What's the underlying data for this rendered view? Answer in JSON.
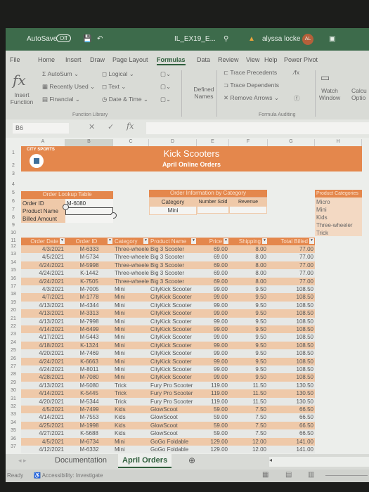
{
  "titlebar": {
    "autosave": "AutoSave",
    "autosave_state": "Off",
    "filename": "IL_EX19_E...",
    "user": "alyssa locke",
    "initials": "AL"
  },
  "ribbon": {
    "tabs": [
      "File",
      "Home",
      "Insert",
      "Draw",
      "Page Layout",
      "Formulas",
      "Data",
      "Review",
      "View",
      "Help",
      "Power Pivot"
    ],
    "active_tab": "Formulas",
    "insert_function": "Insert Function",
    "autosum": "AutoSum",
    "recently_used": "Recently Used",
    "financial": "Financial",
    "logical": "Logical",
    "text": "Text",
    "date_time": "Date & Time",
    "function_library": "Function Library",
    "defined_names": "Defined Names",
    "trace_precedents": "Trace Precedents",
    "trace_dependents": "Trace Dependents",
    "remove_arrows": "Remove Arrows",
    "formula_auditing": "Formula Auditing",
    "watch_window": "Watch Window",
    "calc_options": "Calcu Optio"
  },
  "formula_bar": {
    "name_box": "B6",
    "value": ""
  },
  "columns": [
    "A",
    "B",
    "C",
    "D",
    "E",
    "F",
    "G",
    "H"
  ],
  "sheet": {
    "logo_text": "CITY SPORTS",
    "title": "Kick Scooters",
    "subtitle": "April Online Orders",
    "lookup": {
      "header": "Order Lookup Table",
      "labels": [
        "Order ID",
        "Product Name",
        "Billed Amount"
      ],
      "order_id": "M-6080"
    },
    "category_info": {
      "header": "Order Information by Category",
      "columns": [
        "Category",
        "Number Sold",
        "Revenue"
      ],
      "category": "Mini"
    },
    "product_categories": {
      "header": "Product Categories",
      "items": [
        "Micro",
        "Mini",
        "Kids",
        "Three-wheeler",
        "Trick"
      ]
    },
    "table_headers": [
      "Order Date",
      "Order ID",
      "Category",
      "Product Name",
      "Price",
      "Shipping",
      "Total Billed"
    ],
    "rows": [
      [
        "4/3/2021",
        "M-6333",
        "Three-wheeler",
        "Big 3 Scooter",
        "69.00",
        "8.00",
        "77.00"
      ],
      [
        "4/5/2021",
        "M-5734",
        "Three-wheeler",
        "Big 3 Scooter",
        "69.00",
        "8.00",
        "77.00"
      ],
      [
        "4/24/2021",
        "M-5998",
        "Three-wheeler",
        "Big 3 Scooter",
        "69.00",
        "8.00",
        "77.00"
      ],
      [
        "4/24/2021",
        "K-1442",
        "Three-wheeler",
        "Big 3 Scooter",
        "69.00",
        "8.00",
        "77.00"
      ],
      [
        "4/24/2021",
        "K-7505",
        "Three-wheeler",
        "Big 3 Scooter",
        "69.00",
        "8.00",
        "77.00"
      ],
      [
        "4/3/2021",
        "M-7005",
        "Mini",
        "CityKick Scooter",
        "99.00",
        "9.50",
        "108.50"
      ],
      [
        "4/7/2021",
        "M-1778",
        "Mini",
        "CityKick Scooter",
        "99.00",
        "9.50",
        "108.50"
      ],
      [
        "4/13/2021",
        "M-4344",
        "Mini",
        "CityKick Scooter",
        "99.00",
        "9.50",
        "108.50"
      ],
      [
        "4/13/2021",
        "M-3313",
        "Mini",
        "CityKick Scooter",
        "99.00",
        "9.50",
        "108.50"
      ],
      [
        "4/13/2021",
        "M-7998",
        "Mini",
        "CityKick Scooter",
        "99.00",
        "9.50",
        "108.50"
      ],
      [
        "4/14/2021",
        "M-6499",
        "Mini",
        "CityKick Scooter",
        "99.00",
        "9.50",
        "108.50"
      ],
      [
        "4/17/2021",
        "M-5443",
        "Mini",
        "CityKick Scooter",
        "99.00",
        "9.50",
        "108.50"
      ],
      [
        "4/18/2021",
        "K-1324",
        "Mini",
        "CityKick Scooter",
        "99.00",
        "9.50",
        "108.50"
      ],
      [
        "4/20/2021",
        "M-7469",
        "Mini",
        "CityKick Scooter",
        "99.00",
        "9.50",
        "108.50"
      ],
      [
        "4/24/2021",
        "K-6663",
        "Mini",
        "CityKick Scooter",
        "99.00",
        "9.50",
        "108.50"
      ],
      [
        "4/24/2021",
        "M-8011",
        "Mini",
        "CityKick Scooter",
        "99.00",
        "9.50",
        "108.50"
      ],
      [
        "4/28/2021",
        "M-7080",
        "Mini",
        "CityKick Scooter",
        "99.00",
        "9.50",
        "108.50"
      ],
      [
        "4/13/2021",
        "M-5080",
        "Trick",
        "Fury Pro Scooter",
        "119.00",
        "11.50",
        "130.50"
      ],
      [
        "4/14/2021",
        "K-5445",
        "Trick",
        "Fury Pro Scooter",
        "119.00",
        "11.50",
        "130.50"
      ],
      [
        "4/20/2021",
        "M-5344",
        "Trick",
        "Fury Pro Scooter",
        "119.00",
        "11.50",
        "130.50"
      ],
      [
        "4/5/2021",
        "M-7499",
        "Kids",
        "GlowScoot",
        "59.00",
        "7.50",
        "66.50"
      ],
      [
        "4/14/2021",
        "M-7553",
        "Kids",
        "GlowScoot",
        "59.00",
        "7.50",
        "66.50"
      ],
      [
        "4/25/2021",
        "M-1998",
        "Kids",
        "GlowScoot",
        "59.00",
        "7.50",
        "66.50"
      ],
      [
        "4/27/2021",
        "K-5688",
        "Kids",
        "GlowScoot",
        "59.00",
        "7.50",
        "66.50"
      ],
      [
        "4/5/2021",
        "M-6734",
        "Mini",
        "GoGo Foldable",
        "129.00",
        "12.00",
        "141.00"
      ],
      [
        "4/12/2021",
        "M-6332",
        "Mini",
        "GoGo Foldable",
        "129.00",
        "12.00",
        "141.00"
      ]
    ]
  },
  "sheet_tabs": [
    "Documentation",
    "April Orders"
  ],
  "active_sheet": "April Orders",
  "status": {
    "ready": "Ready",
    "accessibility": "Accessibility: Investigate"
  },
  "colors": {
    "accent": "#e4874c",
    "band": "#efc9a9",
    "excel_green": "#3d6b4b"
  }
}
